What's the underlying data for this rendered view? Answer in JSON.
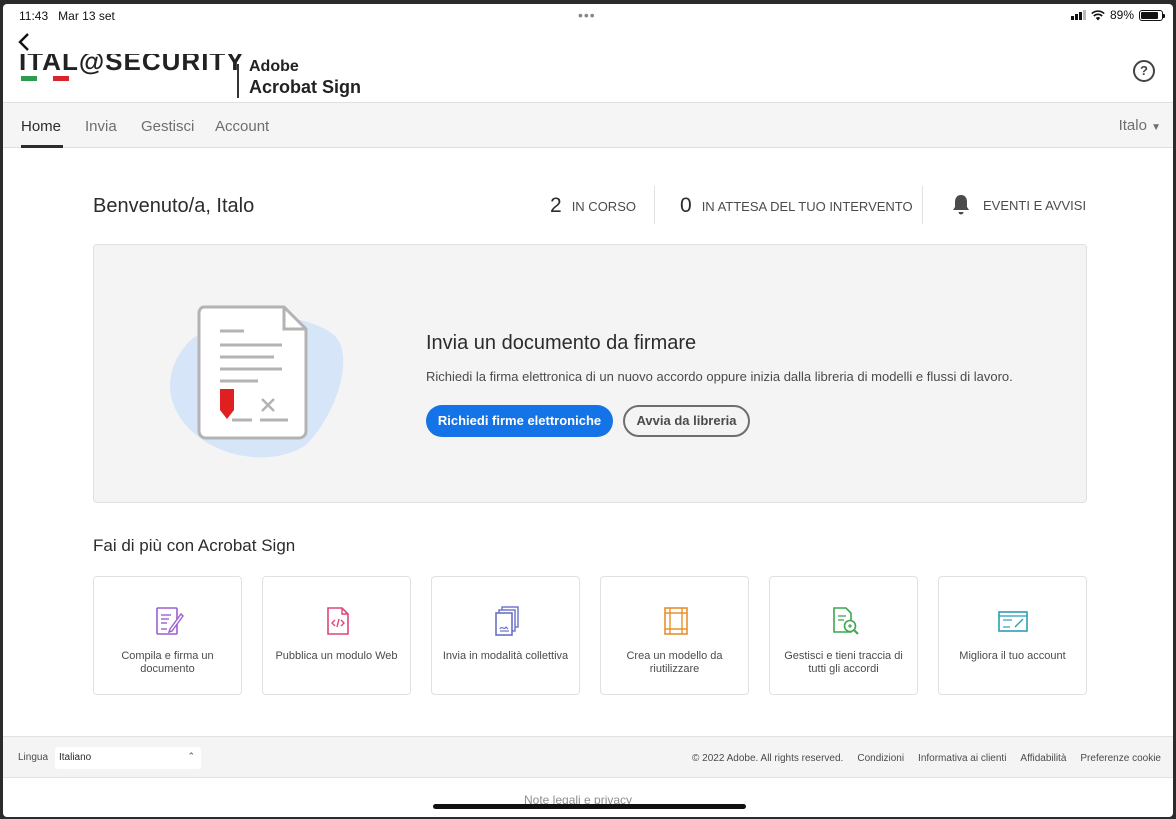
{
  "statusbar": {
    "time": "11:43",
    "date": "Mar 13 set",
    "battery": "89%",
    "battery_level": 0.89
  },
  "header": {
    "logo_brand": "ITAL@SECURITY",
    "logo_adobe": "Adobe",
    "logo_product": "Acrobat Sign",
    "help_label": "?"
  },
  "nav": {
    "items": [
      {
        "label": "Home"
      },
      {
        "label": "Invia"
      },
      {
        "label": "Gestisci"
      },
      {
        "label": "Account"
      }
    ],
    "user": "Italo"
  },
  "dashboard": {
    "welcome": "Benvenuto/a, Italo",
    "in_progress_count": "2",
    "in_progress_label": "IN CORSO",
    "waiting_count": "0",
    "waiting_label": "IN ATTESA DEL TUO INTERVENTO",
    "events_label": "EVENTI E AVVISI"
  },
  "hero": {
    "title": "Invia un documento da firmare",
    "description": "Richiedi la firma elettronica di un nuovo accordo oppure inizia dalla libreria di modelli e flussi di lavoro.",
    "primary_button": "Richiedi firme elettroniche",
    "secondary_button": "Avvia da libreria"
  },
  "more": {
    "title": "Fai di più con Acrobat Sign",
    "tiles": [
      {
        "label": "Compila e firma un documento",
        "icon": "fill-sign-icon",
        "color": "#9b5fd0"
      },
      {
        "label": "Pubblica un modulo Web",
        "icon": "web-form-icon",
        "color": "#e0447c"
      },
      {
        "label": "Invia in modalità collettiva",
        "icon": "mega-sign-icon",
        "color": "#6a6fc8"
      },
      {
        "label": "Crea un modello da riutilizzare",
        "icon": "template-icon",
        "color": "#e8902c"
      },
      {
        "label": "Gestisci e tieni traccia di tutti gli accordi",
        "icon": "manage-track-icon",
        "color": "#3da74e"
      },
      {
        "label": "Migliora il tuo account",
        "icon": "upgrade-account-icon",
        "color": "#2a9fb5"
      }
    ]
  },
  "footer": {
    "lang_label": "Lingua",
    "lang_value": "Italiano",
    "copyright": "© 2022 Adobe. All rights reserved.",
    "links": [
      "Condizioni",
      "Informativa ai clienti",
      "Affidabilità",
      "Preferenze cookie"
    ]
  },
  "bottom_text": "Note legali e privacy",
  "colors": {
    "accent": "#1473e6",
    "hero_bg": "#f4f4f4",
    "illustration_blob": "#d6e6f8",
    "pen_red": "#e02020"
  }
}
